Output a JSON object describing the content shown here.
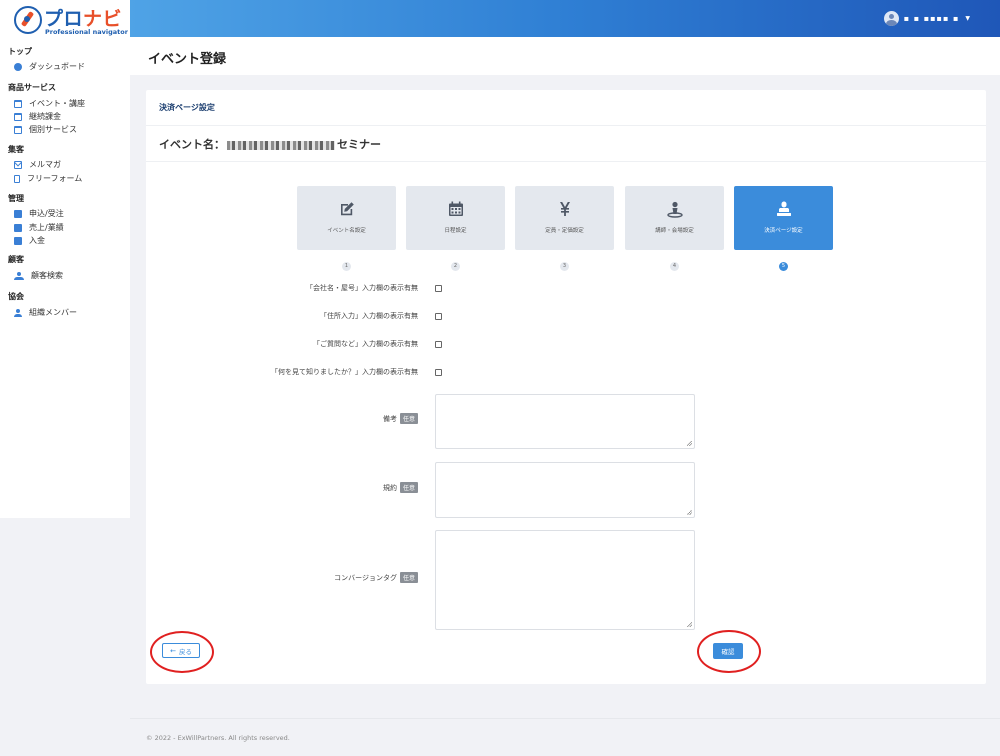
{
  "brand": {
    "logo_main": "プロ",
    "logo_accent": "ナビ",
    "logo_sub": "Professional navigator"
  },
  "sidebar": {
    "sections": [
      {
        "title": "トップ",
        "items": [
          {
            "label": "ダッシュボード",
            "icon": "dashboard-icon"
          }
        ]
      },
      {
        "title": "商品サービス",
        "items": [
          {
            "label": "イベント・講座",
            "icon": "calendar-icon"
          },
          {
            "label": "継続課金",
            "icon": "calendar-icon"
          },
          {
            "label": "個別サービス",
            "icon": "calendar-icon"
          }
        ]
      },
      {
        "title": "集客",
        "items": [
          {
            "label": "メルマガ",
            "icon": "mail-icon"
          },
          {
            "label": "フリーフォーム",
            "icon": "form-icon"
          }
        ]
      },
      {
        "title": "管理",
        "items": [
          {
            "label": "申込/受注",
            "icon": "box-icon"
          },
          {
            "label": "売上/業績",
            "icon": "box-icon"
          },
          {
            "label": "入金",
            "icon": "box-icon"
          }
        ]
      },
      {
        "title": "顧客",
        "items": [
          {
            "label": "顧客検索",
            "icon": "users-icon"
          }
        ]
      },
      {
        "title": "協会",
        "items": [
          {
            "label": "組織メンバー",
            "icon": "user-icon"
          }
        ]
      }
    ]
  },
  "topbar": {
    "user_name": "▪ ▪ ▪▪▪▪ ▪",
    "caret": "▼"
  },
  "page": {
    "title": "イベント登録"
  },
  "card": {
    "head_title": "決済ページ設定",
    "event_label_prefix": "イベント名：",
    "event_label_suffix": "セミナー"
  },
  "steps": [
    {
      "label": "イベント名設定",
      "num": "1",
      "icon": "edit-icon",
      "active": false
    },
    {
      "label": "日程設定",
      "num": "2",
      "icon": "calendar-icon",
      "active": false
    },
    {
      "label": "定員・定価設定",
      "num": "3",
      "icon": "yen-icon",
      "active": false
    },
    {
      "label": "講師・会場設定",
      "num": "4",
      "icon": "location-icon",
      "active": false
    },
    {
      "label": "決済ページ設定",
      "num": "5",
      "icon": "stamp-icon",
      "active": true
    }
  ],
  "form": {
    "checks": [
      "「会社名・屋号」入力欄の表示有無",
      "「住所入力」入力欄の表示有無",
      "「ご質問など」入力欄の表示有無",
      "「何を見て知りましたか？」入力欄の表示有無"
    ],
    "optional_badge": "任意",
    "fields": [
      "備考",
      "規約",
      "コンバージョンタグ"
    ]
  },
  "buttons": {
    "back": "戻る",
    "back_arrow": "←",
    "confirm": "確認"
  },
  "footer": {
    "text": "© 2022 - ExWillPartners. All rights reserved."
  },
  "colors": {
    "accent": "#3b8cdb",
    "brand_blue": "#1f5fb0",
    "brand_orange": "#e8502a",
    "annotation_red": "#e02020"
  }
}
